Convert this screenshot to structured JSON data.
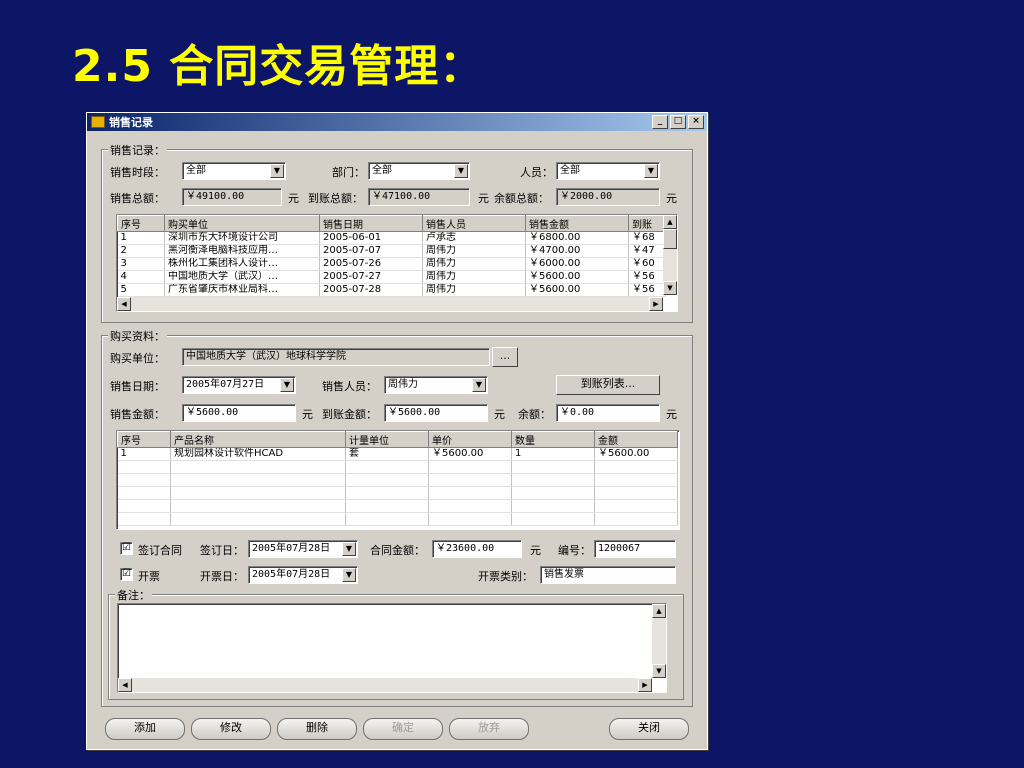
{
  "slide": {
    "title": "2.5 合同交易管理："
  },
  "window": {
    "title": "销售记录",
    "min": "_",
    "max": "□",
    "close": "×"
  },
  "sales": {
    "group_label": "销售记录：",
    "period_label": "销售时段：",
    "period_value": "全部",
    "dept_label": "部门：",
    "dept_value": "全部",
    "person_label": "人员：",
    "person_value": "全部",
    "total_label": "销售总额：",
    "total_value": "￥49100.00",
    "unit": "元",
    "received_label": "到账总额：",
    "received_value": "￥47100.00",
    "balance_label": "余额总额：",
    "balance_value": "￥2000.00",
    "columns": [
      "序号",
      "购买单位",
      "销售日期",
      "销售人员",
      "销售金额",
      "到账"
    ],
    "rows": [
      [
        "1",
        "深圳市东大环境设计公司",
        "2005-06-01",
        "卢承志",
        "￥6800.00",
        "￥68"
      ],
      [
        "2",
        "黑河衡泽电脑科技应用…",
        "2005-07-07",
        "周伟力",
        "￥4700.00",
        "￥47"
      ],
      [
        "3",
        "株州化工集团科人设计…",
        "2005-07-26",
        "周伟力",
        "￥6000.00",
        "￥60"
      ],
      [
        "4",
        "中国地质大学（武汉）…",
        "2005-07-27",
        "周伟力",
        "￥5600.00",
        "￥56"
      ],
      [
        "5",
        "广东省肇庆市林业局科…",
        "2005-07-28",
        "周伟力",
        "￥5600.00",
        "￥56"
      ]
    ]
  },
  "purchase": {
    "group_label": "购买资料：",
    "buyer_label": "购买单位：",
    "buyer_value": "中国地质大学（武汉）地球科学学院",
    "browse": "...",
    "date_label": "销售日期：",
    "date_value": "2005年07月27日",
    "seller_label": "销售人员：",
    "seller_value": "周伟力",
    "list_button": "到账列表...",
    "amount_label": "销售金额：",
    "amount_value": "￥5600.00",
    "unit": "元",
    "received_label": "到账金额：",
    "received_value": "￥5600.00",
    "balance_label": "余额：",
    "balance_value": "￥0.00",
    "columns": [
      "序号",
      "产品名称",
      "计量单位",
      "单价",
      "数量",
      "金额"
    ],
    "rows": [
      [
        "1",
        "规划园林设计软件HCAD",
        "套",
        "￥5600.00",
        "1",
        "￥5600.00"
      ]
    ],
    "contract_check": "☑",
    "contract_label": "签订合同",
    "sign_date_label": "签订日：",
    "sign_date_value": "2005年07月28日",
    "contract_amount_label": "合同金额：",
    "contract_amount_value": "￥23600.00",
    "number_label": "编号：",
    "number_value": "1200067",
    "invoice_check": "☑",
    "invoice_label": "开票",
    "invoice_date_label": "开票日：",
    "invoice_date_value": "2005年07月28日",
    "invoice_type_label": "开票类别：",
    "invoice_type_value": "销售发票",
    "memo_label": "备注："
  },
  "buttons": {
    "add": "添加",
    "edit": "修改",
    "delete": "删除",
    "ok": "确定",
    "cancel": "放弃",
    "close": "关闭"
  }
}
